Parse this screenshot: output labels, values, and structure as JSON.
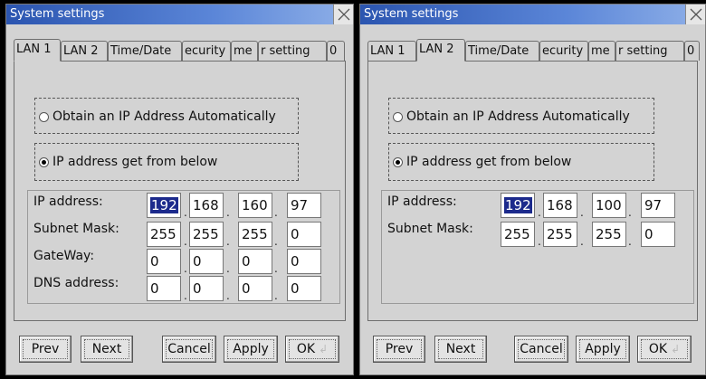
{
  "windows": [
    {
      "title": "System settings",
      "tabs": [
        "LAN 1",
        "LAN 2",
        "Time/Date",
        "ecurity",
        "me",
        "r setting",
        "0"
      ],
      "radio_auto": "Obtain an IP Address Automatically",
      "radio_manual": "IP address get from below",
      "fields": [
        {
          "label": "IP address:",
          "octets": [
            "192",
            "168",
            "160",
            "97"
          ]
        },
        {
          "label": "Subnet Mask:",
          "octets": [
            "255",
            "255",
            "255",
            "0"
          ]
        },
        {
          "label": "GateWay:",
          "octets": [
            "0",
            "0",
            "0",
            "0"
          ]
        },
        {
          "label": "DNS address:",
          "octets": [
            "0",
            "0",
            "0",
            "0"
          ]
        }
      ],
      "buttons": {
        "prev": "Prev",
        "next": "Next",
        "cancel": "Cancel",
        "apply": "Apply",
        "ok": "OK"
      }
    },
    {
      "title": "System settings",
      "tabs": [
        "LAN 1",
        "LAN 2",
        "Time/Date",
        "ecurity",
        "me",
        "r setting",
        "0"
      ],
      "radio_auto": "Obtain an IP Address Automatically",
      "radio_manual": "IP address get from below",
      "fields": [
        {
          "label": "IP address:",
          "octets": [
            "192",
            "168",
            "100",
            "97"
          ]
        },
        {
          "label": "Subnet Mask:",
          "octets": [
            "255",
            "255",
            "255",
            "0"
          ]
        }
      ],
      "buttons": {
        "prev": "Prev",
        "next": "Next",
        "cancel": "Cancel",
        "apply": "Apply",
        "ok": "OK"
      }
    }
  ],
  "icons": {
    "close": "close-icon",
    "ok_glyph": "enter-arrow-icon"
  },
  "colors": {
    "titlebar": "#2b55b0",
    "selection": "#1c2a8c",
    "window_bg": "#d3d3d3"
  }
}
